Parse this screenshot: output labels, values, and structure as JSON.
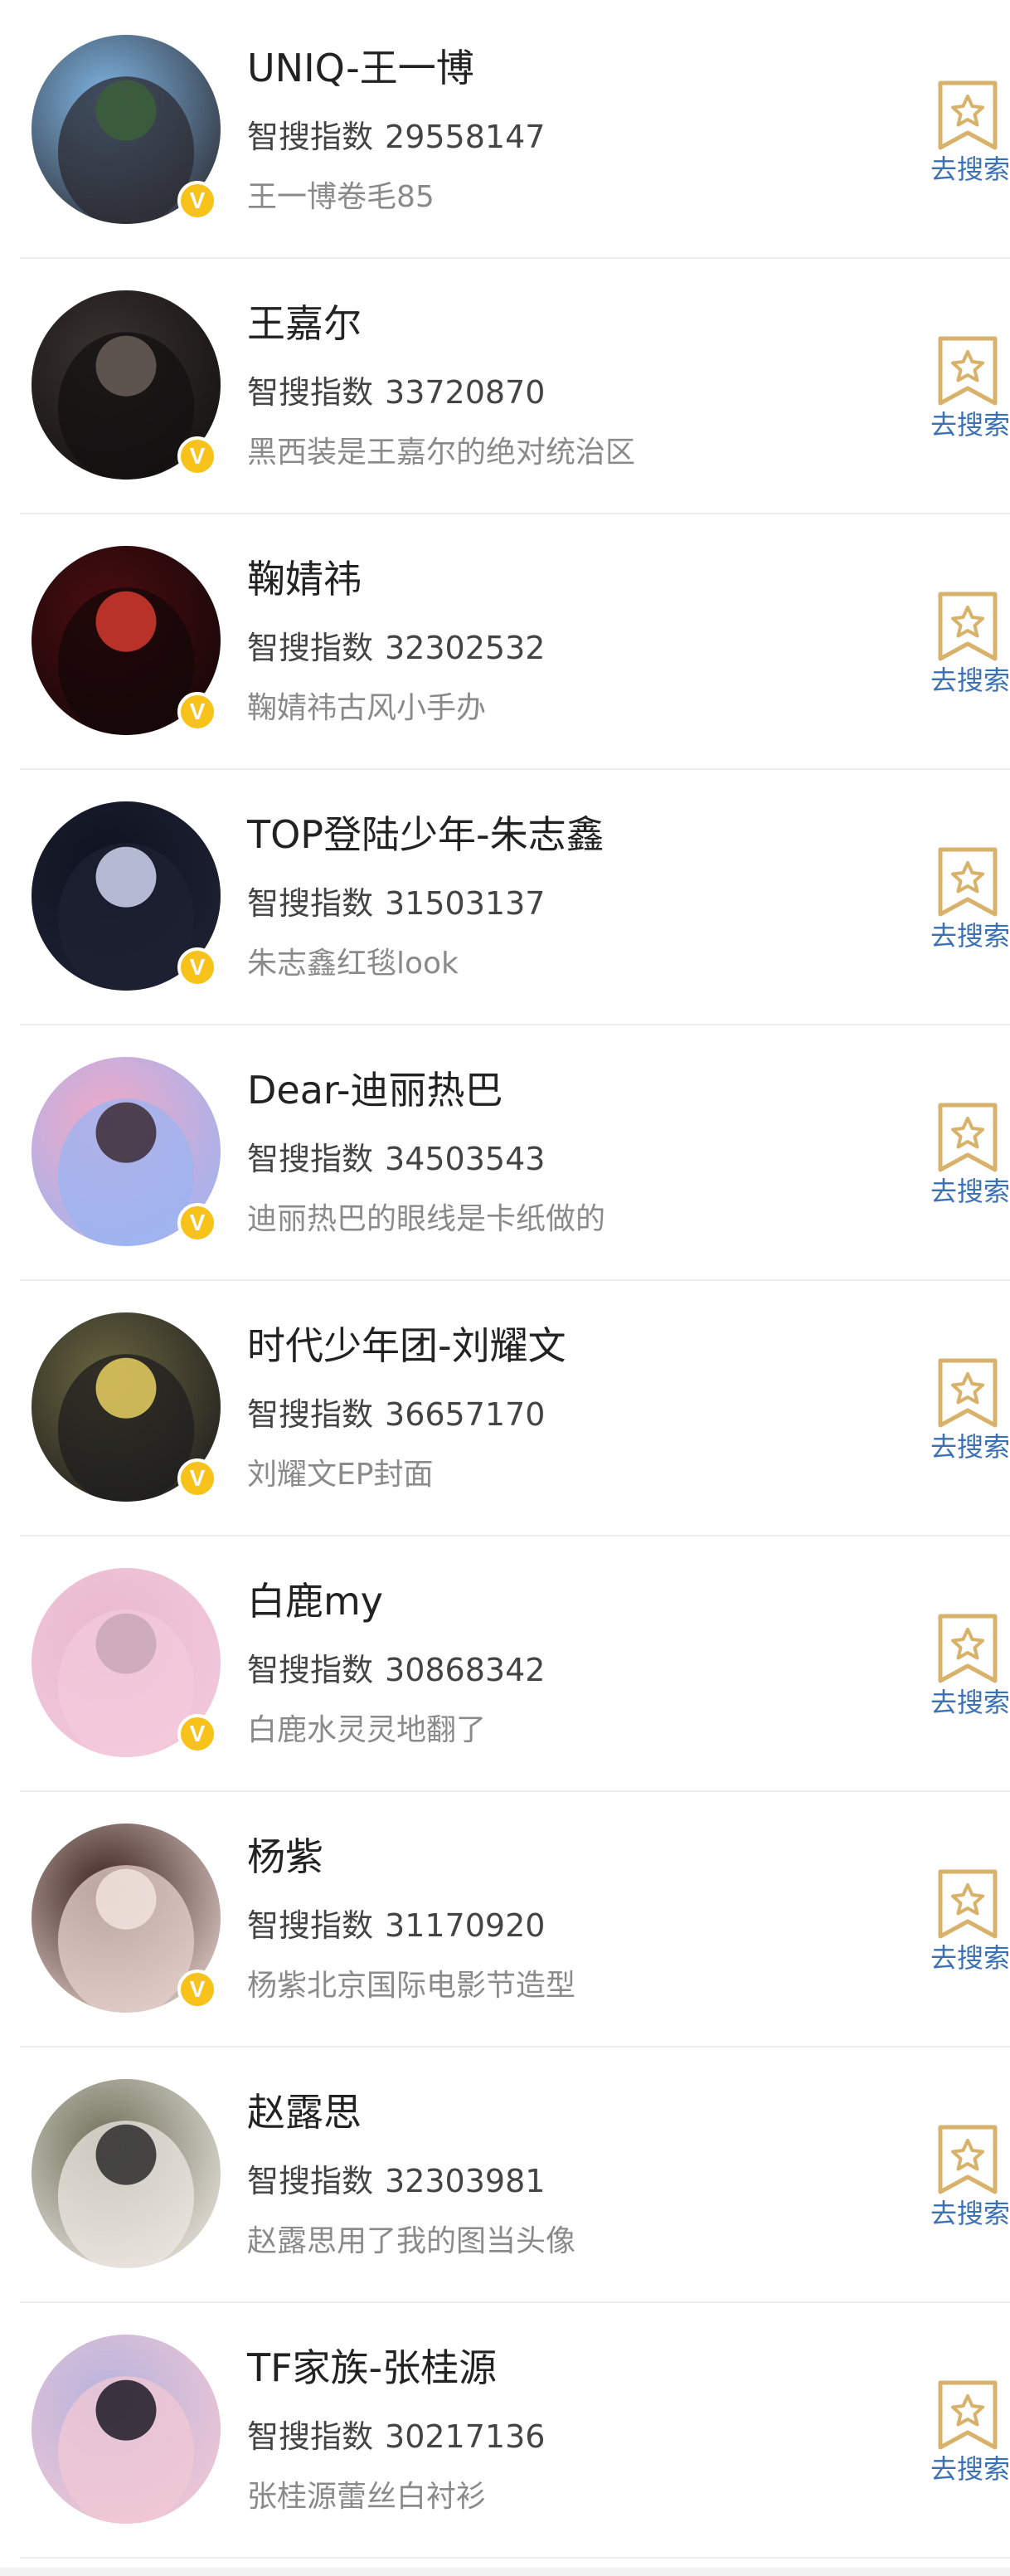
{
  "index_label": "智搜指数",
  "action_label": "去搜索",
  "verified_badge": "V",
  "colors": {
    "accent_link": "#3a71b5",
    "verified_badge": "#f7c21a",
    "bookmark_stroke": "#d8b26a"
  },
  "items": [
    {
      "name": "UNIQ-王一博",
      "index": "29558147",
      "desc": "王一博卷毛85",
      "verified": true,
      "avatar_colors": [
        "#7fb6e4",
        "#2b2a30",
        "#3c5f3a"
      ]
    },
    {
      "name": "王嘉尔",
      "index": "33720870",
      "desc": "黑西装是王嘉尔的绝对统治区",
      "verified": true,
      "avatar_colors": [
        "#3a3330",
        "#121010",
        "#6a5e58"
      ]
    },
    {
      "name": "鞠婧祎",
      "index": "32302532",
      "desc": "鞠婧祎古风小手办",
      "verified": true,
      "avatar_colors": [
        "#4a0d10",
        "#140708",
        "#d33a2f"
      ]
    },
    {
      "name": "TOP登陆少年-朱志鑫",
      "index": "31503137",
      "desc": "朱志鑫红毯look",
      "verified": true,
      "avatar_colors": [
        "#0f1220",
        "#1e2233",
        "#cfd6ef"
      ]
    },
    {
      "name": "Dear-迪丽热巴",
      "index": "34503543",
      "desc": "迪丽热巴的眼线是卡纸做的",
      "verified": true,
      "avatar_colors": [
        "#f1a9c6",
        "#9bb4f2",
        "#3a2a35"
      ]
    },
    {
      "name": "时代少年团-刘耀文",
      "index": "36657170",
      "desc": "刘耀文EP封面",
      "verified": true,
      "avatar_colors": [
        "#6a6540",
        "#1d1d1d",
        "#e9d062"
      ]
    },
    {
      "name": "白鹿my",
      "index": "30868342",
      "desc": "白鹿水灵灵地翻了",
      "verified": true,
      "avatar_colors": [
        "#e9b9cf",
        "#f3c9dc",
        "#c9a7b7"
      ]
    },
    {
      "name": "杨紫",
      "index": "31170920",
      "desc": "杨紫北京国际电影节造型",
      "verified": true,
      "avatar_colors": [
        "#3b2320",
        "#e6d2cc",
        "#f1e3dd"
      ]
    },
    {
      "name": "赵露思",
      "index": "32303981",
      "desc": "赵露思用了我的图当头像",
      "verified": false,
      "avatar_colors": [
        "#6d6f58",
        "#ece7e2",
        "#2b2b2b"
      ]
    },
    {
      "name": "TF家族-张桂源",
      "index": "30217136",
      "desc": "张桂源蕾丝白衬衫",
      "verified": false,
      "avatar_colors": [
        "#b7b3dd",
        "#f2c8d4",
        "#1c1a22"
      ]
    }
  ]
}
